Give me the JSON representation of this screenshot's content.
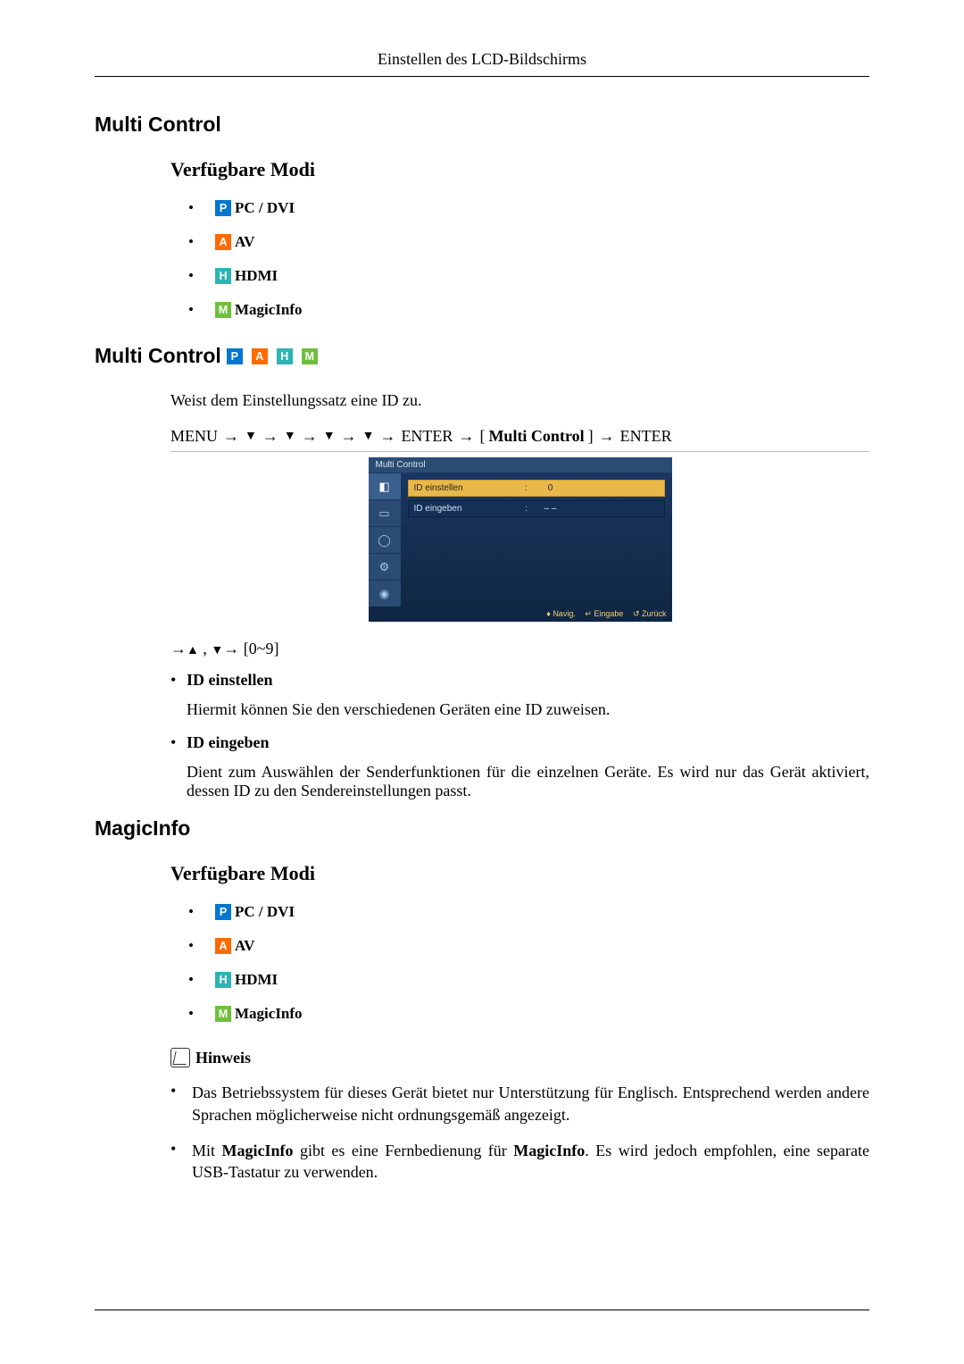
{
  "header": "Einstellen des LCD-Bildschirms",
  "section1": {
    "title": "Multi Control",
    "modes_title": "Verfügbare Modi",
    "modes": {
      "pc": "PC / DVI",
      "av": "AV",
      "hdmi": "HDMI",
      "magic": "MagicInfo"
    }
  },
  "section2": {
    "title": "Multi Control",
    "intro": "Weist dem Einstellungssatz eine ID zu.",
    "nav": {
      "menu": "MENU",
      "enter1": "ENTER",
      "lbrk": "[",
      "mc": "Multi Control",
      "rbrk": "]",
      "enter2": "ENTER"
    },
    "osd": {
      "title": "Multi Control",
      "row1_label": "ID einstellen",
      "row1_value": "0",
      "row2_label": "ID eingeben",
      "row2_value": "– –",
      "footer_nav": "Navig.",
      "footer_enter": "Eingabe",
      "footer_back": "Zurück"
    },
    "range": "[0~9]",
    "items": {
      "id_set_title": "ID einstellen",
      "id_set_desc": "Hiermit können Sie den verschiedenen Geräten eine ID zuweisen.",
      "id_in_title": "ID eingeben",
      "id_in_desc": "Dient zum Auswählen der Senderfunktionen für die einzelnen Geräte. Es wird nur das Gerät aktiviert, dessen ID zu den Sendereinstellungen passt."
    }
  },
  "section3": {
    "title": "MagicInfo",
    "modes_title": "Verfügbare Modi",
    "modes": {
      "pc": "PC / DVI",
      "av": "AV",
      "hdmi": "HDMI",
      "magic": "MagicInfo"
    },
    "note_label": "Hinweis",
    "notes": {
      "n1": "Das Betriebssystem für dieses Gerät bietet nur Unterstützung für Englisch. Entsprechend werden andere Sprachen möglicherweise nicht ordnungsgemäß angezeigt.",
      "n2_a": "Mit ",
      "n2_b1": "MagicInfo",
      "n2_c": " gibt es eine Fernbedienung für ",
      "n2_b2": "MagicInfo",
      "n2_d": ". Es wird jedoch empfohlen, eine separate USB-Tastatur zu verwenden."
    }
  }
}
